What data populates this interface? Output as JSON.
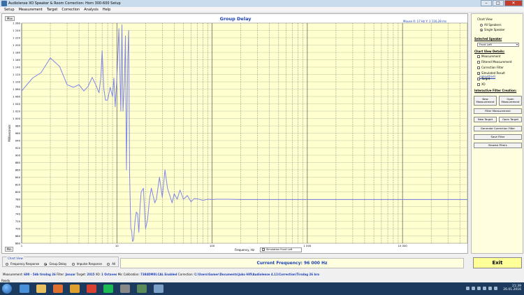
{
  "window": {
    "title": "Audiolense XO Speaker & Room Correction: Horn 300-600 Setup"
  },
  "menu": [
    "Setup",
    "Measurement",
    "Target",
    "Correction",
    "Analysis",
    "Help"
  ],
  "plot": {
    "title": "Group Delay",
    "max_button": "Max",
    "min_button": "Min",
    "mouse_readout": "Mouse X: 17 Hz    Y: 1 116,28 ms",
    "legend": "Simulation Front Left"
  },
  "chart_data": {
    "type": "line",
    "title": "Group Delay",
    "xlabel": "Frequency, Hz",
    "ylabel": "Milliseconds",
    "x_scale": "log",
    "xlim": [
      1,
      48000
    ],
    "ylim": [
      660,
      1260
    ],
    "x_tick_labels": [
      "1",
      "10",
      "100",
      "1 000",
      "10 000"
    ],
    "y_tick_labels": [
      "660",
      "680",
      "700",
      "720",
      "740",
      "760",
      "780",
      "800",
      "820",
      "840",
      "860",
      "880",
      "900",
      "920",
      "940",
      "960",
      "980",
      "1 000",
      "1 020",
      "1 040",
      "1 060",
      "1 080",
      "1 100",
      "1 120",
      "1 140",
      "1 160",
      "1 180",
      "1 200",
      "1 220",
      "1 240",
      "1 260"
    ],
    "grid": true,
    "legend_position": "bottom-center",
    "series": [
      {
        "name": "Simulation Front Left",
        "color": "#7f86e8",
        "x": [
          1,
          1.3,
          1.6,
          2,
          2.5,
          3,
          3.5,
          4,
          4.5,
          5,
          5.5,
          6,
          6.5,
          6.8,
          7,
          7.3,
          7.6,
          8,
          8.5,
          9,
          9.3,
          9.6,
          10,
          10.5,
          11,
          11.3,
          11.6,
          12,
          12.3,
          12.6,
          13,
          13.3,
          13.6,
          14,
          14.3,
          14.6,
          15,
          15.5,
          16,
          16.5,
          17,
          17.5,
          18,
          19,
          20,
          21,
          22,
          23,
          24,
          25,
          26,
          28,
          30,
          32,
          34,
          36,
          38,
          40,
          43,
          46,
          50,
          55,
          60,
          65,
          70,
          75,
          80,
          90,
          100,
          110,
          120,
          150,
          200,
          300,
          500,
          1000,
          2000,
          5000,
          10000,
          20000,
          48000
        ],
        "y": [
          1075,
          1110,
          1125,
          1165,
          1142,
          1092,
          1085,
          1092,
          1075,
          1088,
          1112,
          1092,
          1070,
          1115,
          1185,
          1080,
          1050,
          1050,
          1085,
          1060,
          1110,
          1032,
          1110,
          1245,
          1020,
          1255,
          1020,
          1100,
          1225,
          860,
          1160,
          1240,
          850,
          700,
          695,
          665,
          670,
          720,
          745,
          740,
          690,
          760,
          800,
          810,
          700,
          725,
          780,
          810,
          790,
          770,
          780,
          840,
          785,
          860,
          810,
          790,
          770,
          795,
          780,
          805,
          780,
          790,
          773,
          782,
          781,
          779,
          777,
          780,
          779,
          780,
          780,
          780,
          779,
          779,
          779,
          779,
          779,
          779,
          779,
          779,
          779
        ]
      }
    ]
  },
  "panel": {
    "chart_view_title": "Chart View",
    "all_speakers": "All Speakers",
    "single_speaker": "Single Speaker",
    "selected_speaker_title": "Selected Speaker",
    "selected_speaker_value": "Front Left",
    "details_title": "Chart View Details:",
    "details": [
      {
        "label": "Measurement",
        "checked": false
      },
      {
        "label": "Filtered Measurement",
        "checked": false
      },
      {
        "label": "Correction Filter",
        "checked": false
      },
      {
        "label": "Simulated Result",
        "checked": true
      },
      {
        "label": "Target",
        "checked": false
      },
      {
        "label": "XO",
        "checked": false
      }
    ],
    "smoothed_label": "(smoothed)",
    "filter_creation_title": "Interactive Filter Creation:",
    "btn_new_measurement": "New Measurement",
    "btn_open_measurement": "Open Measurement",
    "btn_filter_measurement": "Filter Measurement",
    "btn_new_target": "New Target",
    "btn_open_target": "Open Target",
    "btn_generate_correction": "Generate Correction Filter",
    "btn_save_filter": "Save Filter",
    "btn_browse_filters": "Browse Filters"
  },
  "chart_view": {
    "title": "Chart View",
    "options": [
      {
        "label": "Frequency Response",
        "selected": false
      },
      {
        "label": "Group Delay",
        "selected": true
      },
      {
        "label": "Impulse Response",
        "selected": false
      },
      {
        "label": "All",
        "selected": false
      }
    ]
  },
  "current_frequency": "Current Frequency: 96 000 Hz",
  "exit_label": "Exit",
  "status": {
    "measurement_label": "Measurement:",
    "measurement_value": "600 - 5db tirsdag 26",
    "filter_label": "Filter:",
    "filter_value": "Januar",
    "target_label": "Target:",
    "target_value": "2015",
    "xo_label": "XO:",
    "xo_value": "1 Octaves",
    "mic_label": "Mic Calibration:",
    "mic_value": "7384DMIII.CAL Enabled",
    "correction_label": "Correction:",
    "correction_value": "C:\\Users\\Gamer\\Documents\\Juko Hifi\\Audiolense 4.11\\Correction\\Tirsdag 26 bra"
  },
  "ready_label": "Ready",
  "taskbar": {
    "time": "21:39",
    "date": "26.01.2016"
  }
}
